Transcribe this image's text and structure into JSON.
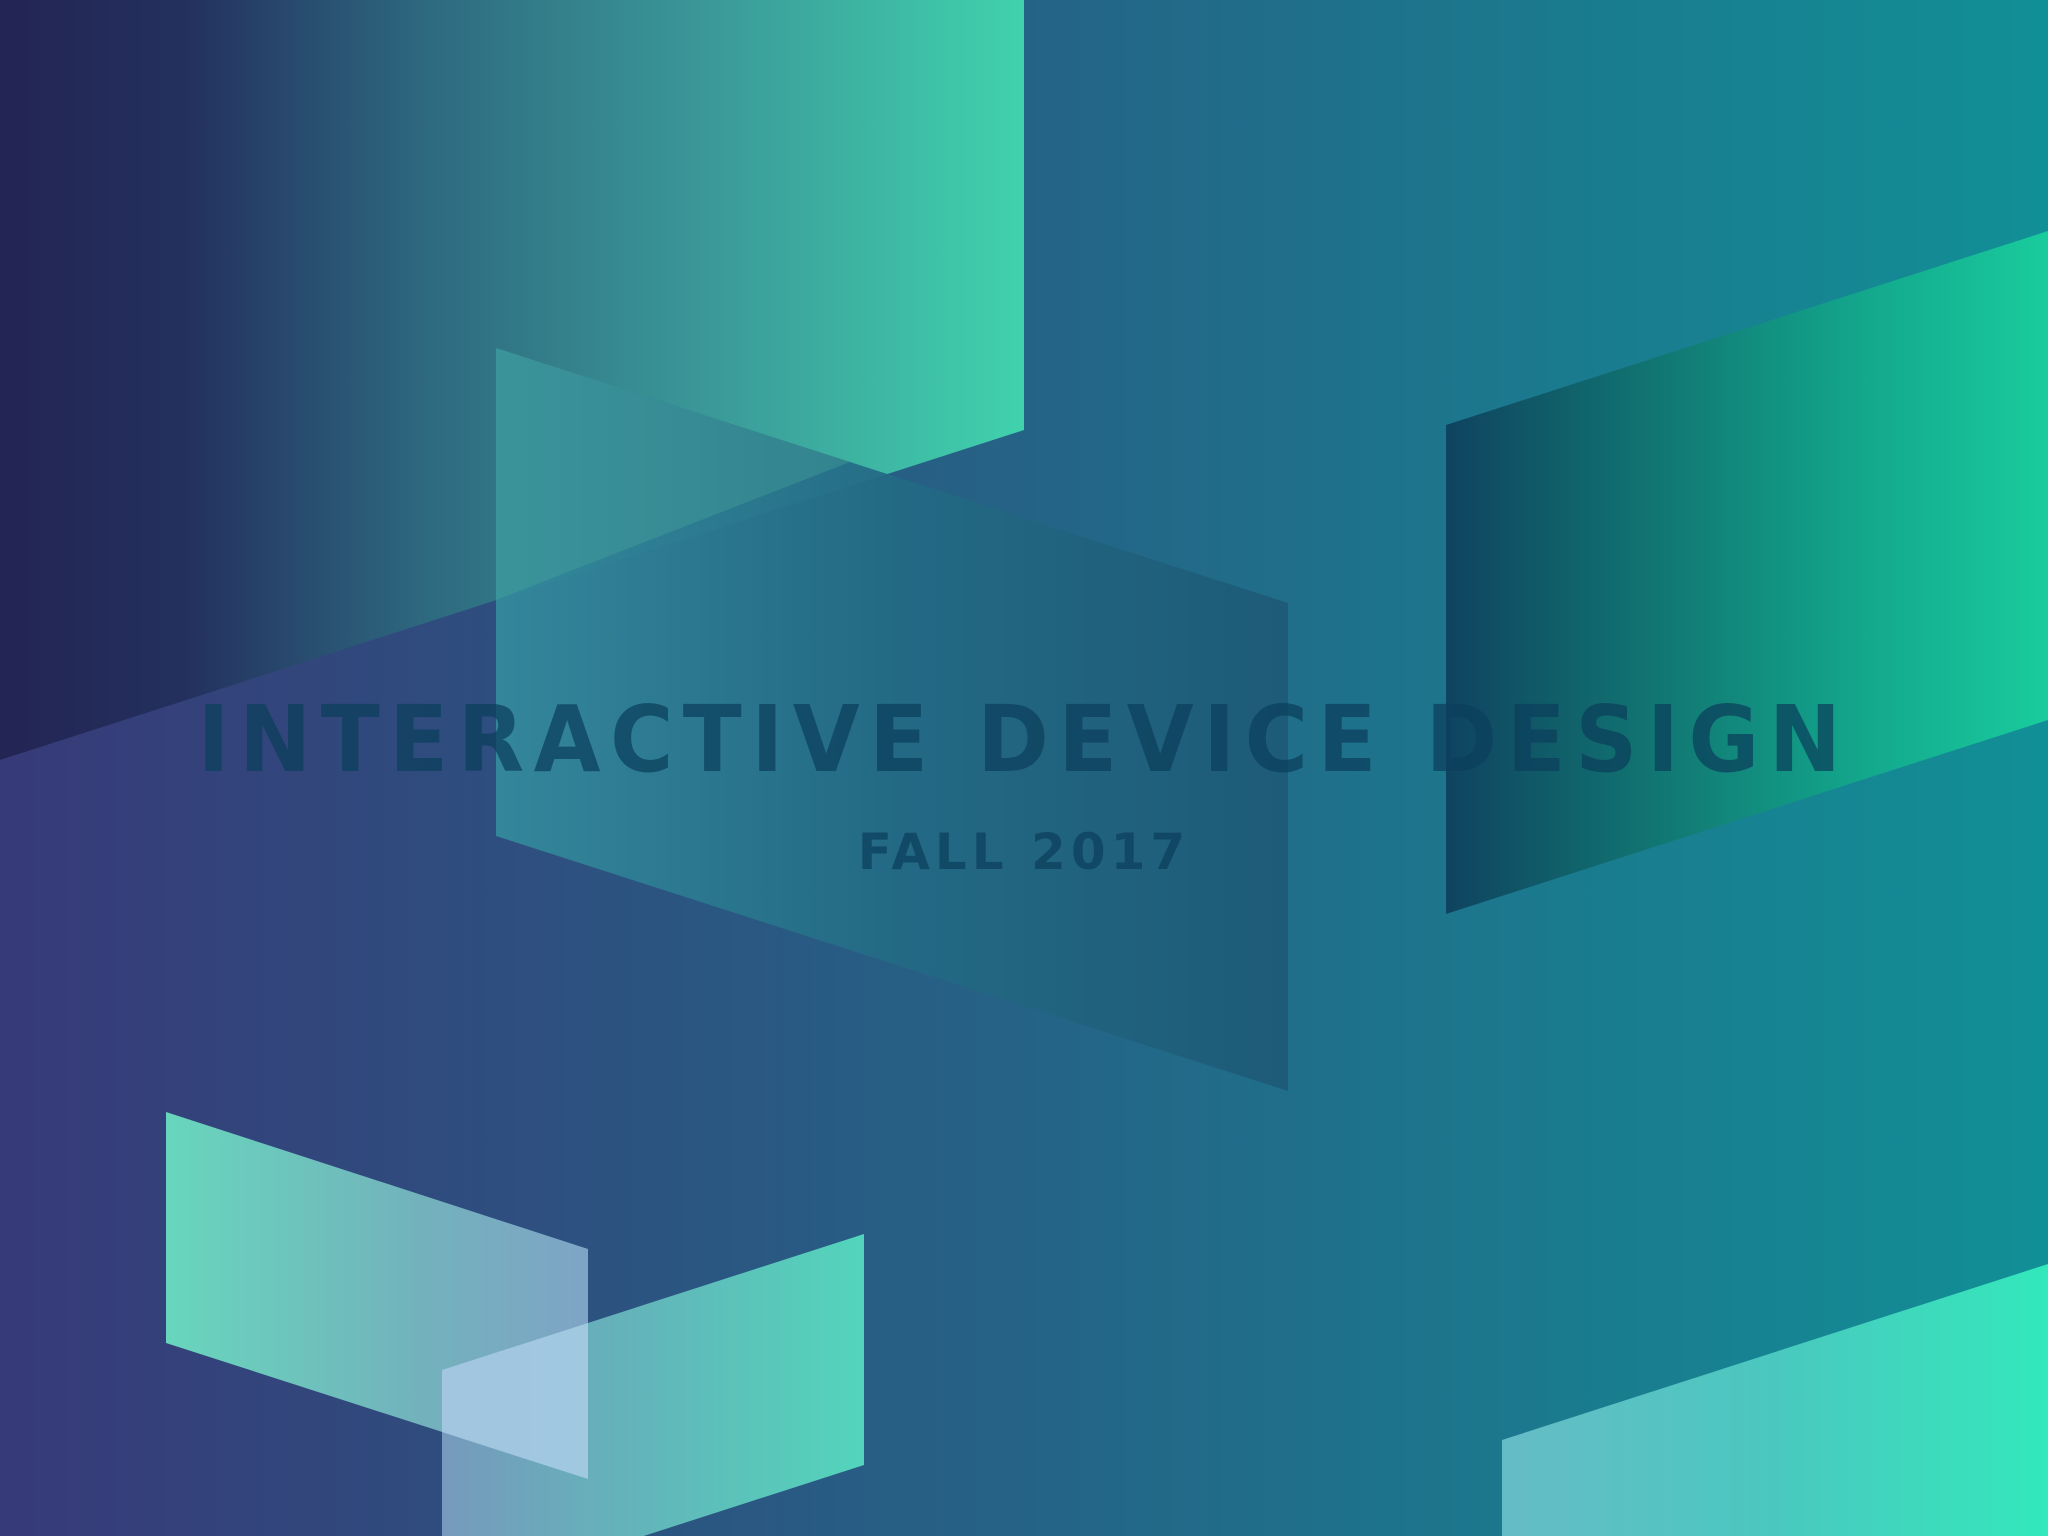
{
  "slide": {
    "title": "INTERACTIVE DEVICE DESIGN",
    "subtitle": "FALL 2017"
  },
  "colors": {
    "background_left": "#373a78",
    "background_mid": "#256386",
    "background_right": "#118f96",
    "accent_mint": "#3fd3ae",
    "accent_teal": "#1acb9c",
    "accent_aqua": "#33e8bb",
    "pale_blue": "#a9cde5",
    "text": "#0b3f5c"
  }
}
